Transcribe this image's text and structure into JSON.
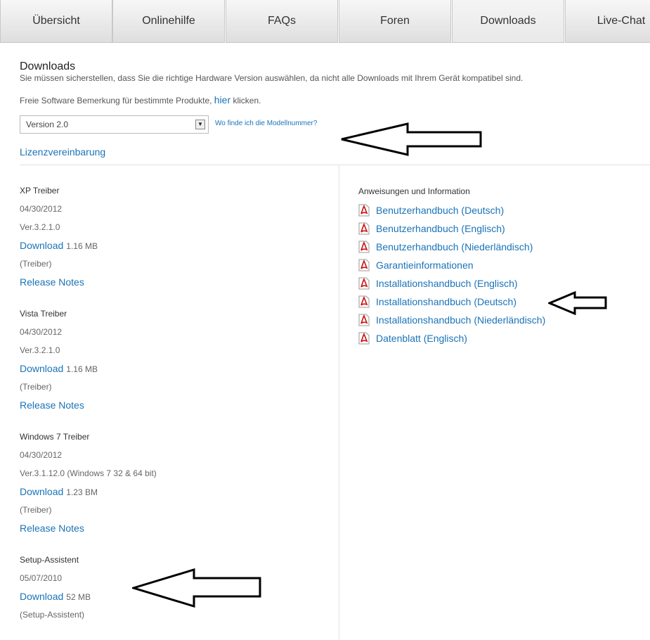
{
  "tabs": [
    "Übersicht",
    "Onlinehilfe",
    "FAQs",
    "Foren",
    "Downloads",
    "Live-Chat"
  ],
  "page": {
    "title": "Downloads",
    "subtitle": "Sie müssen sicherstellen, dass Sie die richtige Hardware Version auswählen, da nicht alle Downloads mit Ihrem Gerät kompatibel sind.",
    "hint_prefix": "Freie Software Bemerkung für bestimmte Produkte, ",
    "hint_link": "hier",
    "hint_suffix": " klicken.",
    "version_select": "Version 2.0",
    "model_link": "Wo finde ich die Modellnummer?",
    "license_link": "Lizenzvereinbarung"
  },
  "drivers": [
    {
      "title": "XP Treiber",
      "date": "04/30/2012",
      "version": "Ver.3.2.1.0",
      "download_label": "Download",
      "size": "1.16 MB",
      "type": "(Treiber)",
      "release_notes": "Release Notes"
    },
    {
      "title": "Vista Treiber",
      "date": "04/30/2012",
      "version": "Ver.3.2.1.0",
      "download_label": "Download",
      "size": "1.16 MB",
      "type": "(Treiber)",
      "release_notes": "Release Notes"
    },
    {
      "title": "Windows 7 Treiber",
      "date": "04/30/2012",
      "version": "Ver.3.1.12.0 (Windows 7 32 & 64 bit)",
      "download_label": "Download",
      "size": "1.23 BM",
      "type": "(Treiber)",
      "release_notes": "Release Notes"
    },
    {
      "title": "Setup-Assistent",
      "date": "05/07/2010",
      "download_label": "Download",
      "size": "52 MB",
      "type": "(Setup-Assistent)"
    }
  ],
  "docs": {
    "title": "Anweisungen und Information",
    "items": [
      "Benutzerhandbuch (Deutsch)",
      "Benutzerhandbuch (Englisch)",
      "Benutzerhandbuch (Niederländisch)",
      "Garantieinformationen",
      "Installationshandbuch (Englisch)",
      "Installationshandbuch (Deutsch)",
      "Installationshandbuch (Niederländisch)",
      "Datenblatt (Englisch)"
    ]
  },
  "icons": {
    "document": "pdf-icon",
    "annotation": "arrow-left-icon",
    "dropdown": "dropdown-arrow-icon"
  },
  "colors": {
    "link": "#1a73b8",
    "tab_bg": "#e4e4e4",
    "pdf": "#cc1111"
  }
}
